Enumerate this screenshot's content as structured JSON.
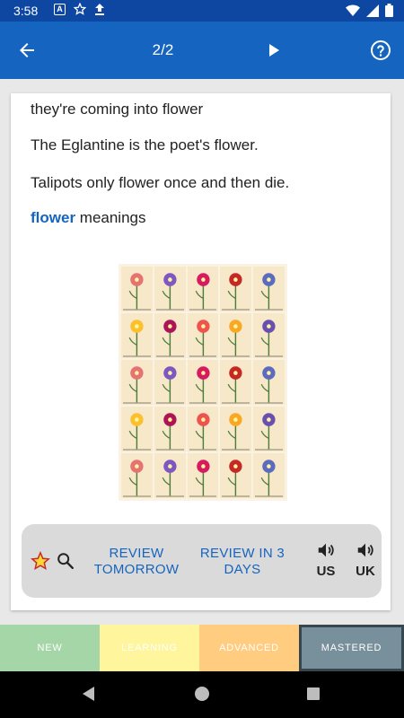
{
  "status_bar": {
    "time": "3:58",
    "icons_left": [
      "font-icon",
      "star-outline-icon",
      "upload-icon"
    ],
    "icons_right": [
      "wifi-icon",
      "signal-icon",
      "battery-icon"
    ]
  },
  "app_bar": {
    "page_counter": "2/2",
    "back_icon": "arrow-back-icon",
    "play_icon": "play-icon",
    "help_icon": "help-circle-icon",
    "color": "#1565c0"
  },
  "card": {
    "examples": [
      "they're coming into flower",
      "The Eglantine is the poet's flower.",
      "Talipots only flower once and then die."
    ],
    "meanings_word": "flower",
    "meanings_suffix": " meanings",
    "image_alt_icon": "flower-chart-image"
  },
  "actions": {
    "star_icon": "star-icon",
    "search_icon": "search-icon",
    "review_tomorrow": "REVIEW TOMORROW",
    "review_three_days": "REVIEW IN 3 DAYS",
    "sound_us_label": "US",
    "sound_uk_label": "UK",
    "sound_icon": "volume-icon"
  },
  "levels": {
    "new": "NEW",
    "learning": "LEARNING",
    "advanced": "ADVANCED",
    "mastered": "MASTERED",
    "selected": "mastered"
  },
  "colors": {
    "accent": "#1565c0",
    "new": "#a5d6a7",
    "learning": "#fff59d",
    "advanced": "#ffcc80",
    "mastered": "#78909c"
  }
}
